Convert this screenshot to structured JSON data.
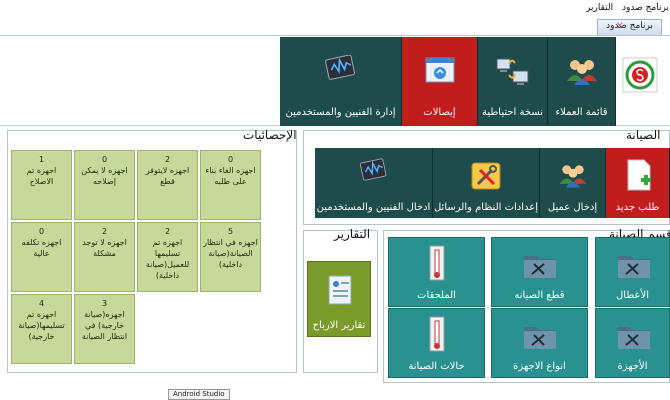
{
  "menu": {
    "app_title": "برنامج صدود",
    "reports": "التقارير"
  },
  "tab": {
    "title": "برنامج صدود",
    "close_glyph": "×"
  },
  "ribbon": {
    "customers": "قائمة العملاء",
    "backup": "نسخة احتياطية",
    "receipts": "إيصالات",
    "technicians": "إدارة الفنيين والمستخدمين"
  },
  "maintenance": {
    "title": "الصيانة",
    "new_request": "طلب جديد",
    "add_customer": "إدخال عميل",
    "settings": "إعدادات النظام والرسائل",
    "add_technicians": "ادخال الفنيين والمستخدمين"
  },
  "stats": {
    "title": "الإحصائيات",
    "cards": [
      {
        "count": "0",
        "label": "اجهزه الغاء بناء على طلبه"
      },
      {
        "count": "2",
        "label": "اجهزه لايتوفر قطع"
      },
      {
        "count": "0",
        "label": "اجهزه لا يمكن إصلاحه"
      },
      {
        "count": "1",
        "label": "اجهزه تم الاصلاح"
      },
      {
        "count": "5",
        "label": "اجهزه في انتظار الصيانة(صيانة داخلية)"
      },
      {
        "count": "2",
        "label": "اجهزه تم تسليمها للعميل(صيانة داخلية)"
      },
      {
        "count": "2",
        "label": "اجهزه لا توجد مشكلة"
      },
      {
        "count": "0",
        "label": "اجهزه تكلفه عالية"
      },
      {
        "count": "3",
        "label": "اجهزه(صيانة خارجية) في انتظار الصيانة"
      },
      {
        "count": "4",
        "label": "اجهزه تم تسليمها(صيانة خارجية)"
      }
    ]
  },
  "reports": {
    "title": "التقارير",
    "profit": "تقارير الارباح"
  },
  "section": {
    "title": "قسم الصيانة",
    "faults": "الأعطال",
    "spare_parts": "قطع الصيانه",
    "accessories": "الملحقات",
    "devices": "الأجهزة",
    "device_types": "انواع الاجهزة",
    "status": "حالات الصيانة"
  },
  "tooltip": "Android Studio",
  "colors": {
    "teal_dark": "#1e4b4b",
    "red": "#c11d1d",
    "teal": "#2a9191",
    "green_card": "#c7d89a",
    "profit_green": "#7a9a2a"
  }
}
